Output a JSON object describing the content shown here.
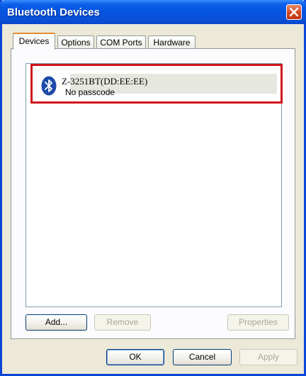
{
  "window": {
    "title": "Bluetooth Devices"
  },
  "tabs": [
    {
      "label": "Devices",
      "active": true
    },
    {
      "label": "Options",
      "active": false
    },
    {
      "label": "COM Ports",
      "active": false
    },
    {
      "label": "Hardware",
      "active": false
    }
  ],
  "devices": [
    {
      "name": "Z-3251BT(DD:EE:EE)",
      "status": "No passcode",
      "icon": "bluetooth-icon"
    }
  ],
  "panel_buttons": {
    "add": "Add...",
    "remove": "Remove",
    "properties": "Properties"
  },
  "dialog_buttons": {
    "ok": "OK",
    "cancel": "Cancel",
    "apply": "Apply"
  },
  "colors": {
    "titlebar": "#0554e0",
    "highlight": "#d0151d",
    "bluetooth": "#1c4aa8"
  }
}
